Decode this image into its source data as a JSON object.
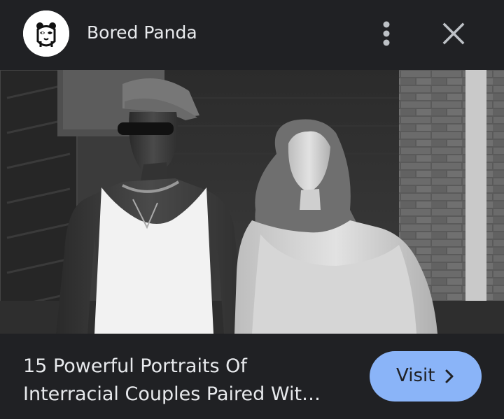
{
  "header": {
    "logo_icon": "panda-logo-icon",
    "site_name": "Bored Panda",
    "more_icon": "more-vert-icon",
    "close_icon": "close-icon"
  },
  "image": {
    "subject": "black-and-white portrait photo"
  },
  "footer": {
    "headline_line1": "15 Powerful Portraits Of",
    "headline_line2": "Interracial Couples Paired Wit…",
    "visit_label": "Visit",
    "visit_icon": "chevron-right-icon"
  },
  "colors": {
    "background": "#202124",
    "text": "#e8eaed",
    "accent": "#8ab4f8"
  }
}
